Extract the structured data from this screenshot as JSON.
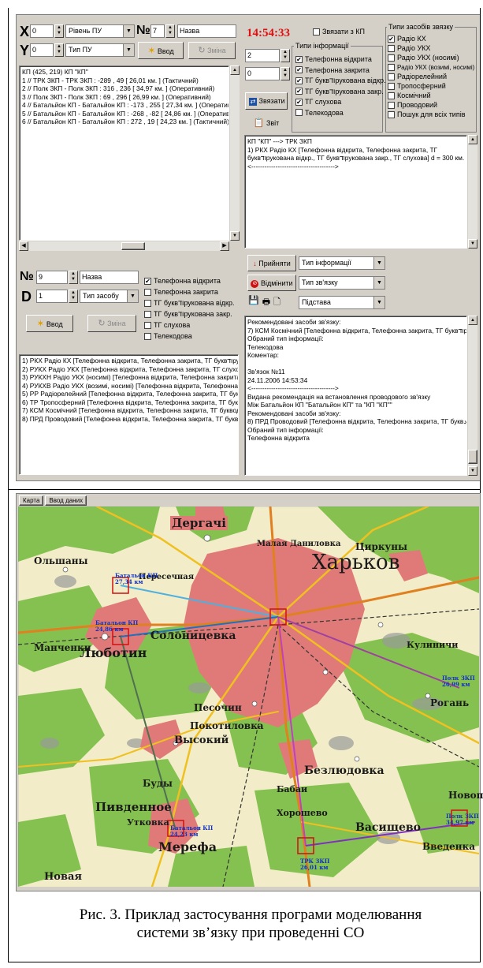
{
  "app": {
    "time": "14:54:33",
    "top_left": {
      "x_letter": "X",
      "x_value": "0",
      "level_combo": "Рівень ПУ",
      "no_symbol": "№",
      "no_value": "7",
      "name_value": "Назва",
      "y_letter": "Y",
      "y_value": "0",
      "type_combo": "Тип ПУ",
      "enter_label": "Ввод",
      "change_label": "Зміна",
      "list": [
        "КП (425, 219) КП \"КП\"",
        "1 // ТРК ЗКП - ТРК ЗКП : -289 , 49  [ 26,01 км. ]  (Тактичний)",
        "2 // Полк ЗКП - Полк ЗКП : 316 , 236  [ 34,97 км. ]  (Оперативний)",
        "3 // Полк ЗКП - Полк ЗКП : 69 , 296  [ 26,99 км. ]  (Оперативний)",
        "4 // Батальйон КП - Батальйон КП : -173 , 255  [ 27,34 км. ]  (Оперативн",
        "5 // Батальйон КП - Батальйон КП : -268 , -82  [ 24,86 км. ]  (Оперативн",
        "6 // Батальйон КП - Батальйон КП : 272 , 19  [ 24,23 км. ]  (Тактичний)"
      ]
    },
    "top_right": {
      "connect_kp_label": "Звязати з КП",
      "spin1": "2",
      "spin2": "0",
      "connect_button": "Звязати",
      "report_button": "Звіт",
      "info_types_title": "Типи інформації",
      "info_types": [
        {
          "label": "Телефонна відкрита",
          "checked": "✔"
        },
        {
          "label": "Телефонна закрита",
          "checked": "✔"
        },
        {
          "label": "ТГ буквודрукована відкр.",
          "checked": "✔"
        },
        {
          "label": "ТГ буквודрукована закр.",
          "checked": "✔"
        },
        {
          "label": "ТГ слухова",
          "checked": "✔"
        },
        {
          "label": "Телекодова",
          "checked": ""
        }
      ],
      "comm_types_title": "Типи засобів звязку",
      "comm_types": [
        {
          "label": "Радіо КХ",
          "checked": "✔"
        },
        {
          "label": "Радіо УКХ",
          "checked": ""
        },
        {
          "label": "Радіо УКХ (носимі)",
          "checked": ""
        },
        {
          "label": "Радіо УКХ (возимі, носимі)",
          "checked": ""
        },
        {
          "label": "Радіорелейний",
          "checked": ""
        },
        {
          "label": "Тропосферний",
          "checked": ""
        },
        {
          "label": "Космічний",
          "checked": ""
        },
        {
          "label": "Проводовий",
          "checked": ""
        },
        {
          "label": "Пошук для всіх типів",
          "checked": ""
        }
      ],
      "result_lines": [
        "КП \"КП\" ---> ТРК ЗКП",
        "1) РКХ Радіо КХ [Телефонна відкрита, Телефонна закрита, ТГ",
        "буквודрукована відкр., ТГ буквודрукована закр., ТГ слухова]   d = 300 км.",
        "<-------------------------------------->"
      ]
    },
    "bottom_left": {
      "no_symbol": "№",
      "no_value": "9",
      "name_value": "Назва",
      "d_letter": "D",
      "d_value": "1",
      "type_combo": "Тип засобу",
      "enter_label": "Ввод",
      "change_label": "Зміна",
      "checks": [
        {
          "label": "Телефонна відкрита",
          "checked": "✔"
        },
        {
          "label": "Телефонна закрита",
          "checked": ""
        },
        {
          "label": "ТГ буквודрукована відкр.",
          "checked": ""
        },
        {
          "label": "ТГ буквודрукована закр.",
          "checked": ""
        },
        {
          "label": "ТГ слухова",
          "checked": ""
        },
        {
          "label": "Телекодова",
          "checked": ""
        }
      ],
      "list": [
        "1) РКХ Радіо КХ [Телефонна відкрита, Телефонна закрита, ТГ буквודру",
        "2) РУКХ Радіо УКХ [Телефонна відкрита, Телефонна закрита, ТГ слухо",
        "3) РУКХН Радіо УКХ (носимі) [Телефонна відкрита, Телефонна закрита",
        "4) РУКХВ Радіо УКХ (возимі, носимі) [Телефонна відкрита, Телефонна",
        "5) РР Радіорелейний [Телефонна відкрита, Телефонна закрита, ТГ букі",
        "6) ТР Тропосферний [Телефонна відкрита, Телефонна закрита, ТГ букі",
        "7) КСМ Космічний [Телефонна відкрита, Телефонна закрита, ТГ буквод",
        "8) ПРД Проводовий [Телефонна відкрита, Телефонна закрита, ТГ букве"
      ]
    },
    "bottom_right": {
      "accept_label": "Прийняти",
      "cancel_label": "Відмінити",
      "info_type_combo": "Тип інформації",
      "link_type_combo": "Тип зв'язку",
      "basis_combo": "Підстава",
      "log_lines": [
        "Рекомендовані засоби зв'язку:",
        "7) КСМ Космічний [Телефонна відкрита, Телефонна закрита, ТГ буквודрукс",
        "Обраний тип інформації:",
        "Телекодова",
        "Коментар:",
        "",
        "Зв'язок №11",
        "24.11.2006  14:53:34",
        "<-------------------------------------->",
        "Видана рекомендація на встановлення проводового зв'язку",
        "Між Батальйон КП \"Батальйон КП\"  та  \"КП \"КП\"\"",
        "Рекомендовані засоби зв'язку:",
        "8) ПРД Проводовий [Телефонна відкрита, Телефонна закрита, ТГ буквودру",
        "Обраний тип інформації:",
        "Телефонна відкрита"
      ]
    }
  },
  "map": {
    "tabs": [
      "Карта",
      "Ввод даних"
    ],
    "labels": {
      "kharkov": "Харьков",
      "dergachi": "Дергачі",
      "lyubotin": "Люботин",
      "pivdenne": "Пивденное",
      "merefa": "Мерефа",
      "solonitsevka": "Солоницевка",
      "vysokiy": "Высокий",
      "peschanoe": "Песочин",
      "pokotilovka": "Покотиловка",
      "bezlyudovka": "Безлюдовка",
      "vasishchevo": "Васищево",
      "budy": "Буды",
      "malaya_danilovka": "Малая Даниловка",
      "tsirkuny": "Циркуны",
      "olshany": "Ольшаны",
      "peresechnaya": "Пересечная",
      "manchenki": "Манченки",
      "kulinichi": "Кулиничи",
      "rogan": "Рогань",
      "vvedenka": "Введенка",
      "novaya": "Новая",
      "babai": "Бабаи",
      "utkovka": "Утковка",
      "khoroshevo": "Хорошево",
      "novopokrovka": "Новопо"
    },
    "unit_labels": {
      "bat1": "Батальон КП",
      "bat1_dist": "24,86 км",
      "bat2": "Батальон КП",
      "bat2_dist": "27,34 км",
      "bat3": "Батальон КП",
      "bat3_dist": "24,23 км",
      "trk": "ТРК ЗКП",
      "trk_dist": "26,01 км",
      "polk1": "Полк ЗКП",
      "polk1_dist": "34,97 км",
      "polk2": "Полк ЗКП",
      "polk2_dist": "26,99 км"
    }
  },
  "caption": {
    "line1": "Рис. 3. Приклад застосування програми моделювання",
    "line2": "системи зв’язку при проведенні СО"
  },
  "colors": {
    "window_bg": "#d4d0c8",
    "time_red": "#e01010",
    "map_green": "#7fbf4a",
    "map_city": "#e07a78"
  }
}
